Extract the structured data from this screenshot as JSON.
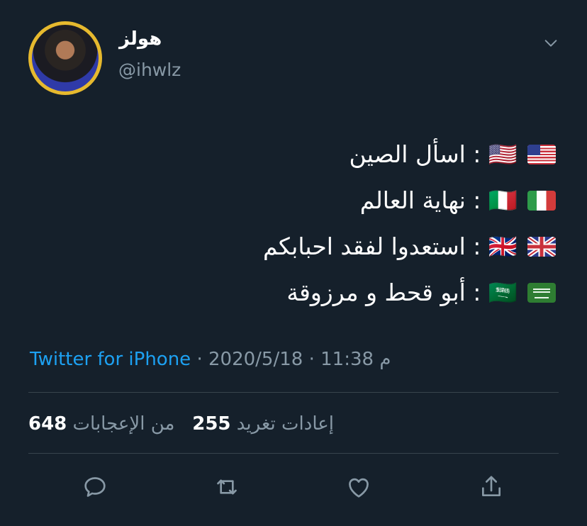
{
  "user": {
    "name": "هولز",
    "handle": "@ihwlz"
  },
  "tweet": {
    "lines": [
      {
        "flag": "us-flag",
        "text": "🇺🇸 : اسأل الصين"
      },
      {
        "flag": "italy-flag",
        "text": "🇮🇹 : نهاية العالم"
      },
      {
        "flag": "uk-flag",
        "text": "🇬🇧 : استعدوا لفقد احبابكم"
      },
      {
        "flag": "saudi-flag",
        "text": "🇸🇦 : أبو قحط و مرزوقة"
      }
    ]
  },
  "meta": {
    "time": "11:38 م",
    "separator1": "·",
    "date": "2020/5/18",
    "separator2": "·",
    "source": "Twitter for iPhone"
  },
  "stats": {
    "likes_count": "648",
    "likes_label": "من الإعجابات",
    "retweets_count": "255",
    "retweets_label": "إعادات تغريد"
  },
  "actions": [
    "reply-icon",
    "retweet-icon",
    "like-icon",
    "share-icon"
  ],
  "colors": {
    "background": "#15202b",
    "secondary_text": "#8899a6",
    "link": "#1da1f2",
    "divider": "#38444d",
    "avatar_ring": "#e6b92e"
  }
}
